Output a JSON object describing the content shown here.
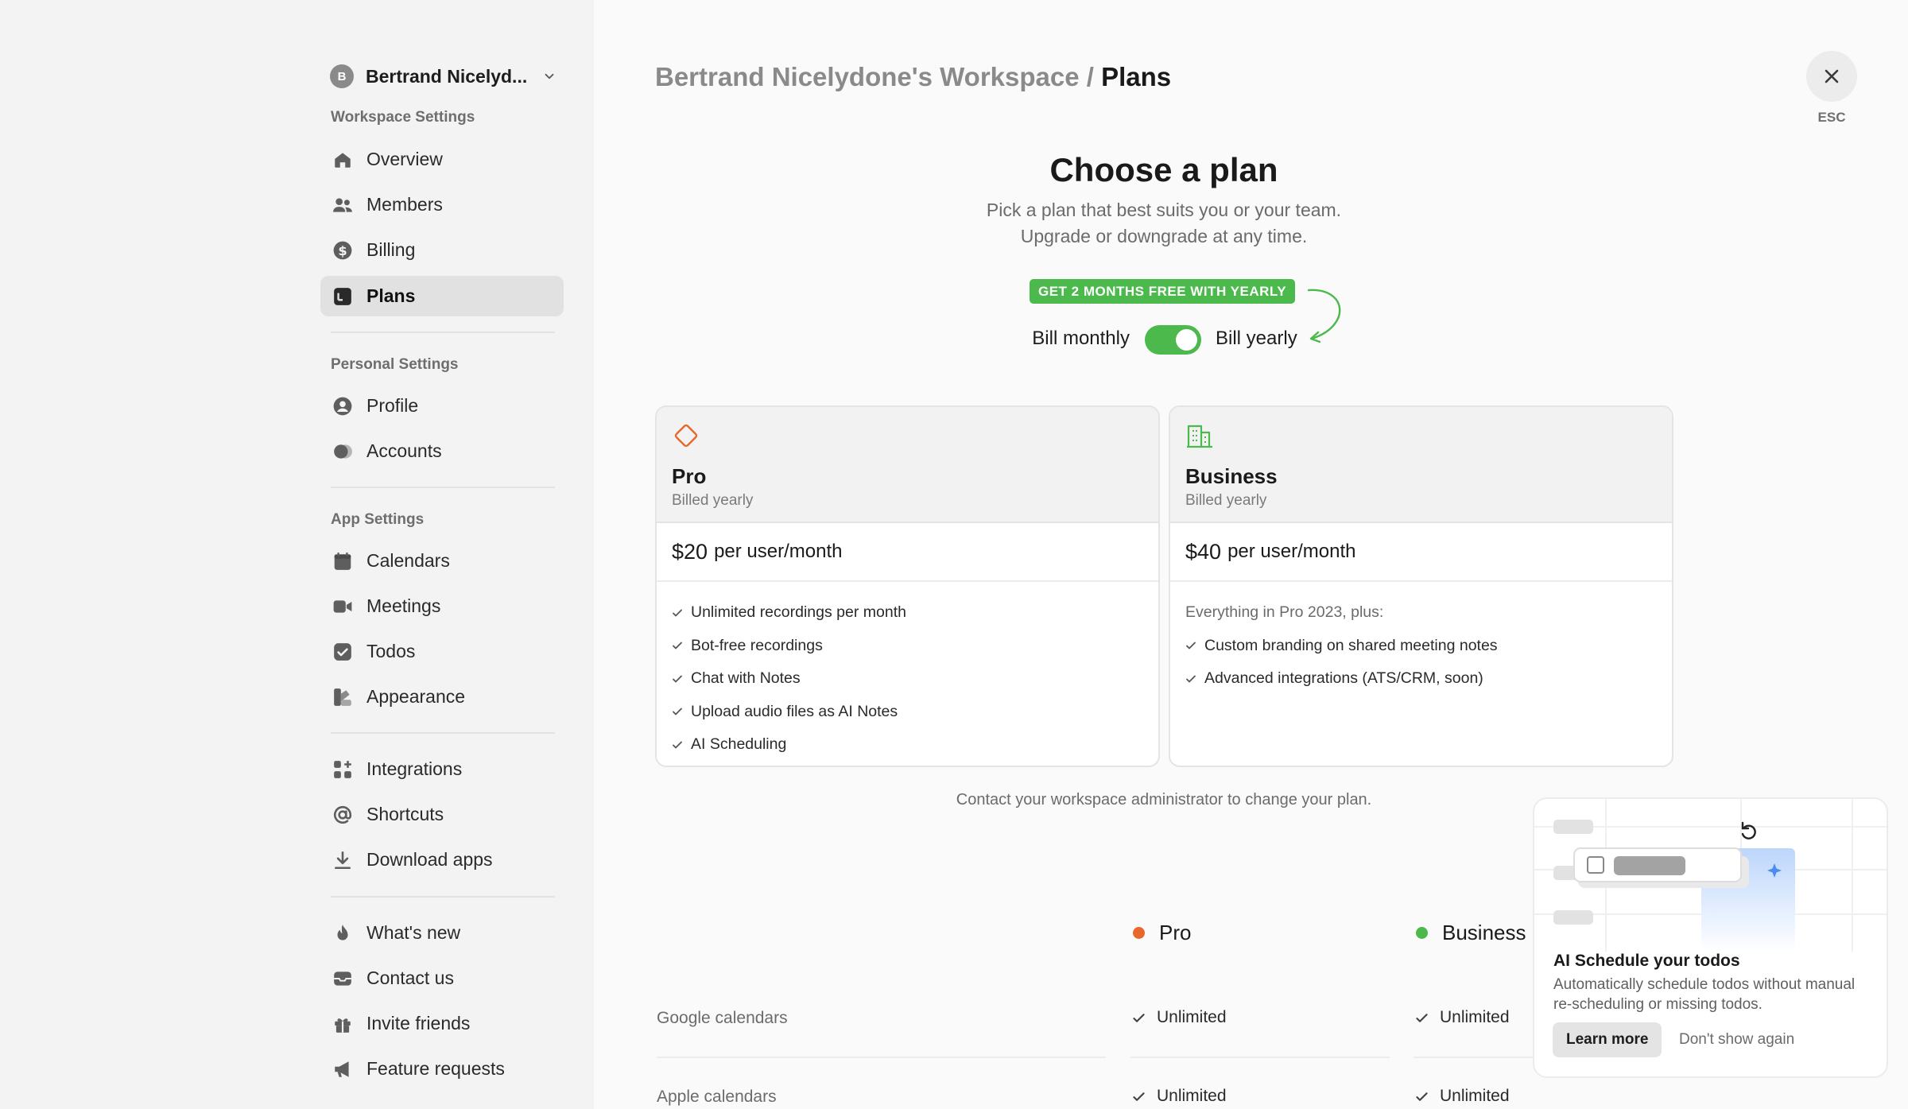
{
  "workspace": {
    "avatar_initial": "B",
    "name": "Bertrand Nicelyd..."
  },
  "sidebar": {
    "workspace_label": "Workspace Settings",
    "workspace_items": [
      {
        "label": "Overview",
        "icon": "home-icon"
      },
      {
        "label": "Members",
        "icon": "users-icon"
      },
      {
        "label": "Billing",
        "icon": "dollar-icon"
      },
      {
        "label": "Plans",
        "icon": "plans-icon",
        "active": true
      }
    ],
    "personal_label": "Personal Settings",
    "personal_items": [
      {
        "label": "Profile",
        "icon": "profile-icon"
      },
      {
        "label": "Accounts",
        "icon": "accounts-icon"
      }
    ],
    "app_label": "App Settings",
    "app_items": [
      {
        "label": "Calendars",
        "icon": "calendar-icon"
      },
      {
        "label": "Meetings",
        "icon": "video-icon"
      },
      {
        "label": "Todos",
        "icon": "todo-icon"
      },
      {
        "label": "Appearance",
        "icon": "appearance-icon"
      }
    ],
    "tool_items": [
      {
        "label": "Integrations",
        "icon": "integrations-icon"
      },
      {
        "label": "Shortcuts",
        "icon": "at-icon"
      },
      {
        "label": "Download apps",
        "icon": "download-icon"
      }
    ],
    "misc_items": [
      {
        "label": "What's new",
        "icon": "fire-icon"
      },
      {
        "label": "Contact us",
        "icon": "inbox-icon"
      },
      {
        "label": "Invite friends",
        "icon": "gift-icon"
      },
      {
        "label": "Feature requests",
        "icon": "megaphone-icon"
      }
    ]
  },
  "header": {
    "workspace_crumb": "Bertrand Nicelydone's Workspace /",
    "current_crumb": "Plans",
    "esc_label": "ESC"
  },
  "hero": {
    "title": "Choose a plan",
    "subtitle": "Pick a plan that best suits you or your team. Upgrade or downgrade at any time.",
    "promo": "GET 2 MONTHS FREE WITH YEARLY",
    "bill_monthly": "Bill monthly",
    "bill_yearly": "Bill yearly",
    "yearly_selected": true
  },
  "plans": [
    {
      "name": "Pro",
      "billed": "Billed yearly",
      "price": "$20",
      "price_unit": "per user/month",
      "accent": "#e8672a",
      "features": [
        "Unlimited recordings per month",
        "Bot-free recordings",
        "Chat with Notes",
        "Upload audio files as AI Notes",
        "AI Scheduling"
      ]
    },
    {
      "name": "Business",
      "billed": "Billed yearly",
      "price": "$40",
      "price_unit": "per user/month",
      "accent": "#4cb94c",
      "intro": "Everything in Pro 2023, plus:",
      "features": [
        "Custom branding on shared meeting notes",
        "Advanced integrations (ATS/CRM, soon)"
      ]
    }
  ],
  "contact_note": "Contact your workspace administrator to change your plan.",
  "comparison": {
    "columns": [
      {
        "name": "Pro",
        "color": "#e8672a"
      },
      {
        "name": "Business",
        "color": "#4cb94c"
      }
    ],
    "rows": [
      {
        "label": "Google calendars",
        "values": [
          "Unlimited",
          "Unlimited"
        ]
      },
      {
        "label": "Apple calendars",
        "values": [
          "Unlimited",
          "Unlimited"
        ]
      }
    ]
  },
  "popup": {
    "title": "AI Schedule your todos",
    "description": "Automatically schedule todos without manual re-scheduling or missing todos.",
    "learn_more": "Learn more",
    "dismiss": "Don't show again"
  },
  "colors": {
    "accent_green": "#4cb94c",
    "accent_orange": "#e8672a",
    "sidebar_bg": "#f3f3f3",
    "main_bg": "#fafafa"
  }
}
